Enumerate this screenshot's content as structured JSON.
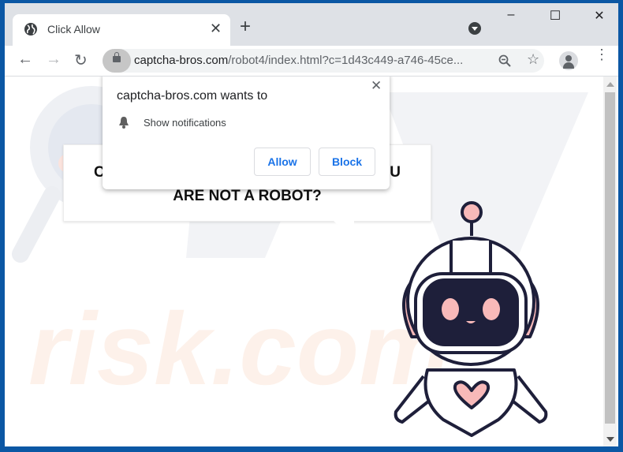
{
  "browser": {
    "tab": {
      "title": "Click Allow",
      "icon": "globe-icon"
    },
    "new_tab_label": "+",
    "window_controls": {
      "minimize": "–",
      "maximize": "☐",
      "close": "✕"
    },
    "nav": {
      "back": "←",
      "forward": "→",
      "reload": "↻"
    },
    "url": {
      "domain": "captcha-bros.com",
      "path": "/robot4/index.html?c=1d43c449-a746-45ce..."
    },
    "omnibox_icons": [
      "zoom-out-icon",
      "bookmark-star-icon"
    ],
    "menu_glyph": "⋮"
  },
  "permission_popup": {
    "title": "captcha-bros.com wants to",
    "permission": "Show notifications",
    "allow_label": "Allow",
    "block_label": "Block",
    "close_glyph": "✕"
  },
  "page": {
    "bubble_line1_left": "C",
    "bubble_line1_right": "U",
    "bubble_line2": "ARE NOT A ROBOT?",
    "watermark_text": "risk.com",
    "colors": {
      "robot_outline": "#1e1f3a",
      "robot_accent": "#f8b9b9",
      "link_blue": "#1a73e8",
      "frame_blue": "#0b57a4"
    }
  }
}
